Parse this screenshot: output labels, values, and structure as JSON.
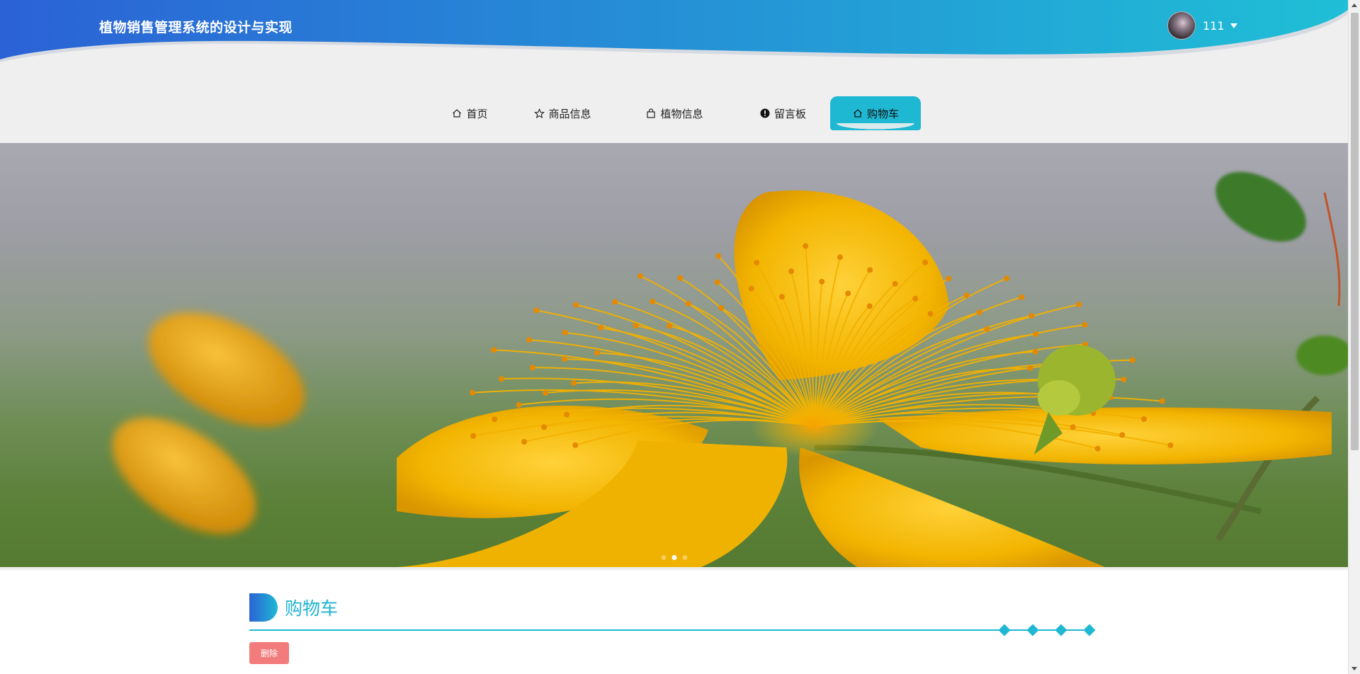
{
  "header": {
    "app_title": "植物销售管理系统的设计与实现",
    "username": "111",
    "avatar_icon": "user-avatar",
    "gradient_start": "#2b62d6",
    "gradient_end": "#1fbfd6"
  },
  "nav": {
    "items": [
      {
        "label": "首页",
        "icon": "home-icon"
      },
      {
        "label": "商品信息",
        "icon": "star-icon"
      },
      {
        "label": "植物信息",
        "icon": "bag-icon"
      },
      {
        "label": "留言板",
        "icon": "info-icon"
      },
      {
        "label": "购物车",
        "icon": "home-icon",
        "active": true
      }
    ],
    "active_color": "#1fb8d3"
  },
  "banner": {
    "slide_count": 3,
    "active_slide": 2
  },
  "cart_section": {
    "title": "购物车",
    "delete_label": "删除",
    "delete_color": "#f27b7b",
    "accent": "#1fb8d3"
  }
}
